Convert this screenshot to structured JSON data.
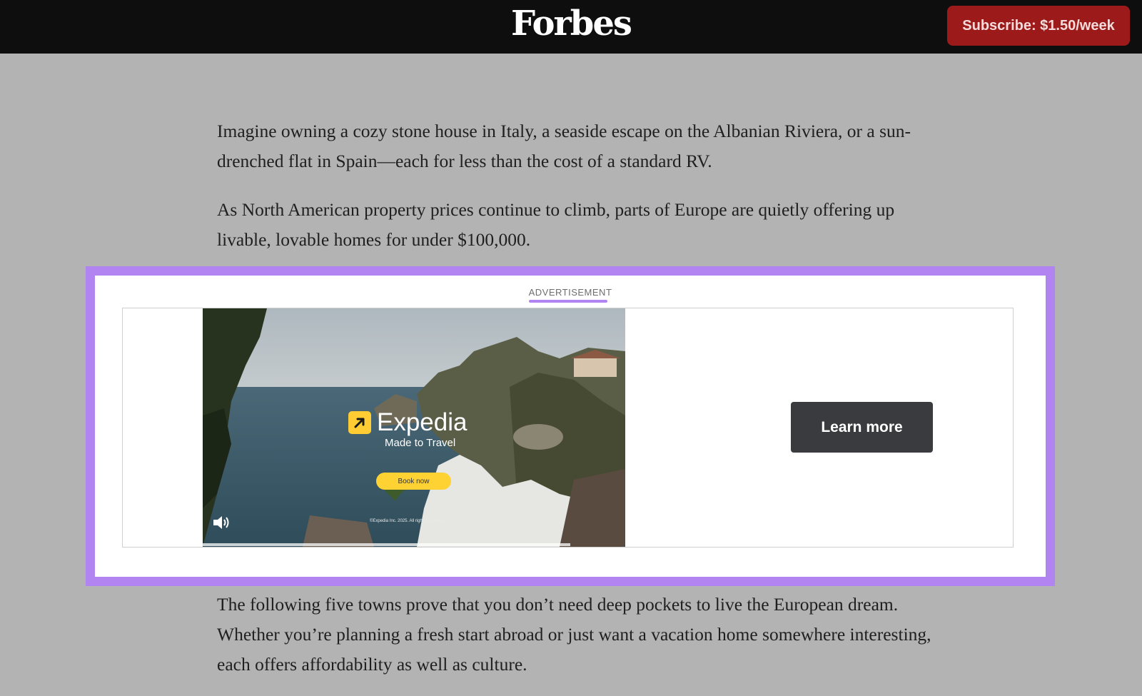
{
  "header": {
    "logo": "Forbes",
    "subscribe_label": "Subscribe: $1.50/week"
  },
  "article": {
    "paragraphs": [
      "Imagine owning a cozy stone house in Italy, a seaside escape on the Albanian Riviera, or a sun-drenched flat in Spain—each for less than the cost of a standard RV.",
      "As North American property prices continue to climb, parts of Europe are quietly offering up livable, lovable homes for under $100,000.",
      "The following five towns prove that you don’t need deep pockets to live the European dream. Whether you’re planning a fresh start abroad or just want a vacation home somewhere interesting, each offers affordability as well as culture."
    ]
  },
  "ad": {
    "label": "ADVERTISEMENT",
    "brand": "Expedia",
    "tagline": "Made to Travel",
    "cta_video": "Book now",
    "copyright": "©Expedia Inc. 2025. All rights reserved.",
    "learn_more_label": "Learn more",
    "video_progress": 0.87,
    "highlight_color": "#b284f2",
    "icons": [
      "expedia-logo-icon",
      "speaker-icon"
    ]
  },
  "colors": {
    "header_bg": "#0e0e0e",
    "subscribe_bg": "#9c1a19",
    "page_bg": "#b3b3b3",
    "learn_more_bg": "#3a3b3f",
    "book_now_bg": "#ffd233"
  }
}
